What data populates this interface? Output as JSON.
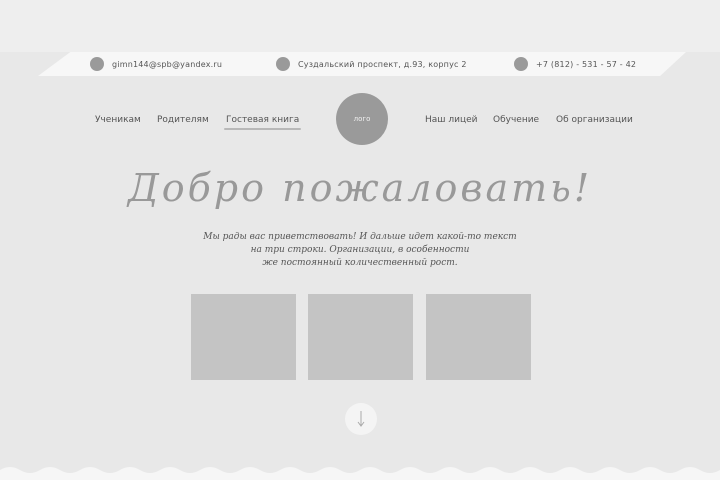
{
  "contacts": {
    "email": "gimn144@spb@yandex.ru",
    "address": "Суздальский проспект, д.93, корпус 2",
    "phone": "+7 (812) - 531 - 57 - 42"
  },
  "nav": {
    "left": [
      "Ученикам",
      "Родителям",
      "Гостевая книга"
    ],
    "right": [
      "Наш лицей",
      "Обучение",
      "Об организации"
    ],
    "active": "Гостевая книга"
  },
  "logo": {
    "label": "лого"
  },
  "hero": {
    "title": "Добро пожаловать!",
    "line1": "Мы рады вас приветствовать! И дальше идет какой-то текст",
    "line2": "на три строки. Организации, в особенности",
    "line3": "же постоянный количественный рост."
  },
  "icons": {
    "scroll": "arrow-down-icon",
    "contact": "circle-icon"
  },
  "colors": {
    "background": "#e8e8e8",
    "placeholder": "#c4c4c4",
    "accent_gray": "#9a9a9a"
  }
}
